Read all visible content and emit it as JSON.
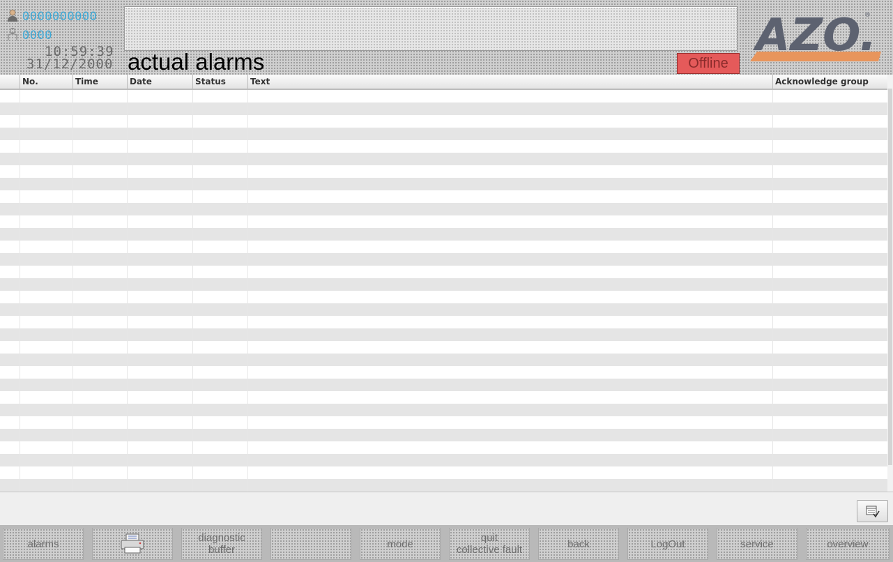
{
  "header": {
    "user_name": "0000000000",
    "user_group": "0000",
    "time": "10:59:39",
    "date": "31/12/2000",
    "page_title": "actual alarms",
    "status_badge": "Offline",
    "logo_text": "AZO.",
    "colors": {
      "status_badge": "#e55a5a",
      "logo_gray": "#5d6270",
      "logo_accent": "#e8955c",
      "user_text": "#3fa9d6"
    }
  },
  "alarm_table": {
    "columns": [
      "No.",
      "Time",
      "Date",
      "Status",
      "Text",
      "Acknowledge group"
    ],
    "rows": []
  },
  "function_keys": [
    {
      "label": "alarms",
      "icon": ""
    },
    {
      "label": "",
      "icon": "printer-icon"
    },
    {
      "label": "diagnostic buffer",
      "line1": "diagnostic",
      "line2": "buffer",
      "icon": ""
    },
    {
      "label": "",
      "icon": ""
    },
    {
      "label": "mode",
      "icon": ""
    },
    {
      "label": "quit collective fault",
      "line1": "quit",
      "line2": "collective fault",
      "icon": ""
    },
    {
      "label": "back",
      "icon": ""
    },
    {
      "label": "LogOut",
      "icon": ""
    },
    {
      "label": "service",
      "icon": ""
    },
    {
      "label": "overview",
      "icon": ""
    }
  ],
  "table_tool_icon": "table-settings-icon"
}
